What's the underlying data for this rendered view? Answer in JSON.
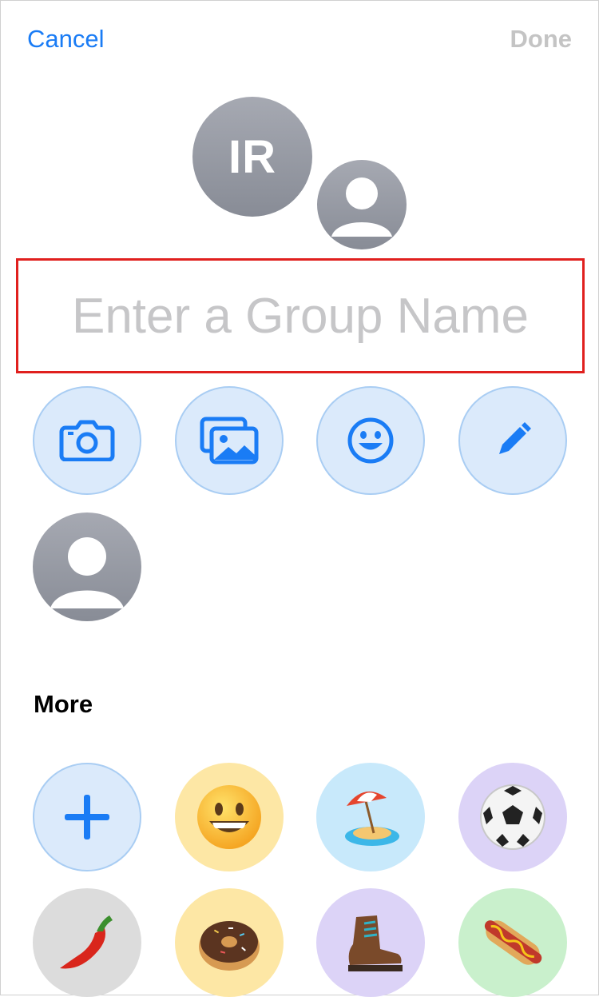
{
  "header": {
    "cancel_label": "Cancel",
    "done_label": "Done"
  },
  "group_avatar": {
    "initials": "IR"
  },
  "group_name": {
    "placeholder": "Enter a Group Name",
    "value": ""
  },
  "tools": [
    {
      "icon": "camera-icon"
    },
    {
      "icon": "photos-icon"
    },
    {
      "icon": "emoji-icon"
    },
    {
      "icon": "pencil-icon"
    }
  ],
  "more": {
    "title": "More",
    "items": [
      {
        "icon": "plus-icon"
      },
      {
        "icon": "grinning-face-emoji"
      },
      {
        "icon": "beach-umbrella-island-emoji"
      },
      {
        "icon": "soccer-ball-emoji"
      },
      {
        "icon": "chili-pepper-emoji"
      },
      {
        "icon": "donut-emoji"
      },
      {
        "icon": "hiking-boot-emoji"
      },
      {
        "icon": "hot-dog-emoji"
      }
    ]
  },
  "colors": {
    "accent": "#1a7cf5",
    "highlight_border": "#e0201e",
    "tool_background": "#dbeafb",
    "disabled_text": "#c4c4c4"
  }
}
